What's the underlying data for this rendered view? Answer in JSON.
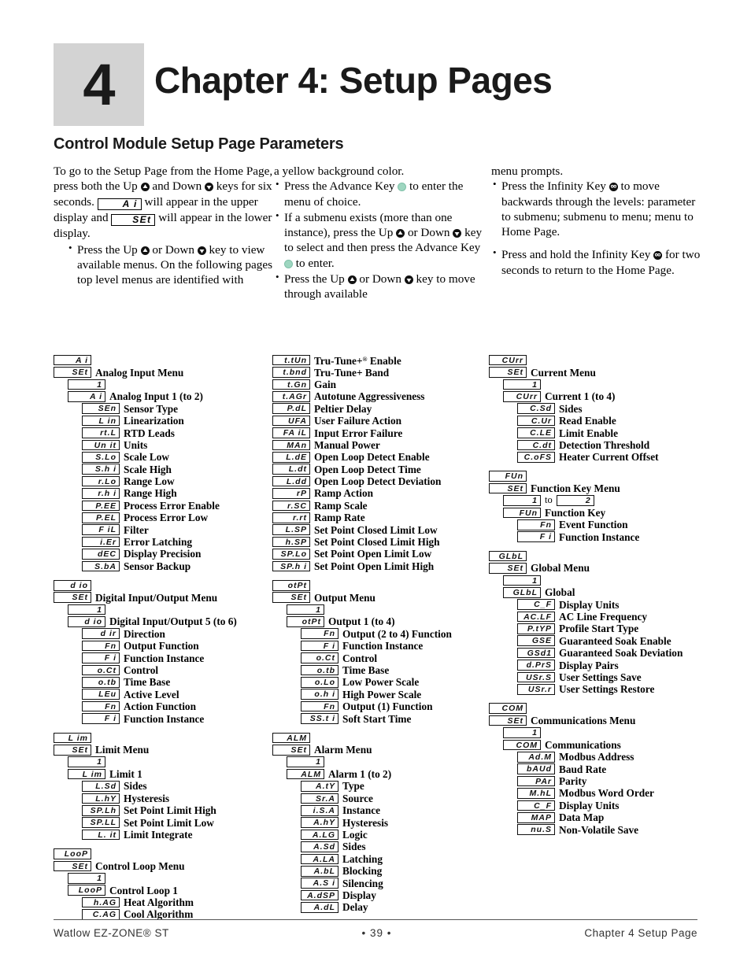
{
  "header": {
    "chapter_number": "4",
    "chapter_title": "Chapter 4: Setup Pages",
    "section_title": "Control Module Setup Page Parameters"
  },
  "intro": {
    "col1": {
      "para_a": "To go to the Setup Page from the Home Page, press both the Up",
      "para_b": "and Down",
      "para_c": "keys for six seconds.",
      "disp_ai": "A i",
      "para_d": "will appear in the upper display and",
      "disp_set": "SEt",
      "para_e": "will appear in the lower display.",
      "bullet1_a": "Press the Up",
      "bullet1_b": "or Down",
      "bullet1_c": "key to view available menus. On the following pages top level menus are identified with"
    },
    "col2": {
      "cont": "a yellow background color.",
      "bullet1_a": "Press the Advance Key",
      "bullet1_b": "to enter the menu of choice.",
      "bullet2_a": "If a submenu exists (more than one instance), press the Up",
      "bullet2_b": "or Down",
      "bullet2_c": "key to select and then press the Advance Key",
      "bullet2_d": "to enter.",
      "bullet3_a": "Press the Up",
      "bullet3_b": "or Down",
      "bullet3_c": "key to move through available"
    },
    "col3": {
      "cont": "menu prompts.",
      "bullet1_a": "Press the Infinity Key",
      "bullet1_b": "to move backwards through the levels: parameter to submenu; submenu to menu; menu to Home Page.",
      "bullet2_a": "Press and hold the Infinity Key",
      "bullet2_b": "for two seconds to return to the Home Page."
    }
  },
  "icons": {
    "up_key": "up-key-icon",
    "down_key": "down-key-icon",
    "advance_key": "advance-key-icon",
    "infinity_key": "infinity-key-icon",
    "advance_color": "#9ed6c0",
    "infinity_color": "#1a1a1a"
  },
  "tree": {
    "column1": [
      {
        "name": "analog-input-menu",
        "rows": [
          {
            "level": 0,
            "code": "A i",
            "label": ""
          },
          {
            "level": 0,
            "code": "SEt",
            "label": "Analog Input Menu"
          },
          {
            "level": 1,
            "code": "1",
            "label": ""
          },
          {
            "level": 1,
            "code": "A i",
            "label": "Analog Input 1 (to 2)"
          },
          {
            "level": 2,
            "code": "SEn",
            "label": "Sensor Type"
          },
          {
            "level": 2,
            "code": "L in",
            "label": "Linearization"
          },
          {
            "level": 2,
            "code": "rt.L",
            "label": "RTD Leads"
          },
          {
            "level": 2,
            "code": "Un it",
            "label": "Units"
          },
          {
            "level": 2,
            "code": "S.Lo",
            "label": "Scale Low"
          },
          {
            "level": 2,
            "code": "S.h i",
            "label": "Scale High"
          },
          {
            "level": 2,
            "code": "r.Lo",
            "label": "Range Low"
          },
          {
            "level": 2,
            "code": "r.h i",
            "label": "Range High"
          },
          {
            "level": 2,
            "code": "P.EE",
            "label": "Process Error Enable"
          },
          {
            "level": 2,
            "code": "P.EL",
            "label": "Process Error Low"
          },
          {
            "level": 2,
            "code": "F iL",
            "label": "Filter"
          },
          {
            "level": 2,
            "code": "i.Er",
            "label": "Error Latching"
          },
          {
            "level": 2,
            "code": "dEC",
            "label": "Display Precision"
          },
          {
            "level": 2,
            "code": "S.bA",
            "label": "Sensor Backup"
          }
        ]
      },
      {
        "name": "digital-io-menu",
        "rows": [
          {
            "level": 0,
            "code": "d io",
            "label": ""
          },
          {
            "level": 0,
            "code": "SEt",
            "label": "Digital Input/Output Menu"
          },
          {
            "level": 1,
            "code": "1",
            "label": ""
          },
          {
            "level": 1,
            "code": "d io",
            "label": "Digital Input/Output 5 (to 6)"
          },
          {
            "level": 2,
            "code": "d ir",
            "label": "Direction"
          },
          {
            "level": 2,
            "code": "Fn",
            "label": "Output Function"
          },
          {
            "level": 2,
            "code": "F i",
            "label": "Function Instance"
          },
          {
            "level": 2,
            "code": "o.Ct",
            "label": "Control"
          },
          {
            "level": 2,
            "code": "o.tb",
            "label": "Time Base"
          },
          {
            "level": 2,
            "code": "LEu",
            "label": "Active Level"
          },
          {
            "level": 2,
            "code": "Fn",
            "label": "Action Function"
          },
          {
            "level": 2,
            "code": "F i",
            "label": "Function Instance"
          }
        ]
      },
      {
        "name": "limit-menu",
        "rows": [
          {
            "level": 0,
            "code": "L im",
            "label": ""
          },
          {
            "level": 0,
            "code": "SEt",
            "label": "Limit Menu"
          },
          {
            "level": 1,
            "code": "1",
            "label": ""
          },
          {
            "level": 1,
            "code": "L im",
            "label": "Limit 1"
          },
          {
            "level": 2,
            "code": "L.Sd",
            "label": "Sides"
          },
          {
            "level": 2,
            "code": "L.hY",
            "label": "Hysteresis"
          },
          {
            "level": 2,
            "code": "SP.Lh",
            "label": "Set Point Limit High"
          },
          {
            "level": 2,
            "code": "SP.LL",
            "label": "Set Point Limit Low"
          },
          {
            "level": 2,
            "code": "L. it",
            "label": "Limit Integrate"
          }
        ]
      },
      {
        "name": "control-loop-menu",
        "rows": [
          {
            "level": 0,
            "code": "LooP",
            "label": ""
          },
          {
            "level": 0,
            "code": "SEt",
            "label": "Control Loop Menu"
          },
          {
            "level": 1,
            "code": "1",
            "label": ""
          },
          {
            "level": 1,
            "code": "LooP",
            "label": "Control Loop 1"
          },
          {
            "level": 2,
            "code": "h.AG",
            "label": "Heat Algorithm"
          },
          {
            "level": 2,
            "code": "C.AG",
            "label": "Cool Algorithm"
          }
        ]
      }
    ],
    "column2": [
      {
        "name": "control-loop-continued",
        "rows": [
          {
            "level": 0,
            "code": "t.tUn",
            "label": "Tru-Tune+® Enable"
          },
          {
            "level": 0,
            "code": "t.bnd",
            "label": "Tru-Tune+ Band"
          },
          {
            "level": 0,
            "code": "t.Gn",
            "label": "Gain"
          },
          {
            "level": 0,
            "code": "t.AGr",
            "label": "Autotune Aggressiveness"
          },
          {
            "level": 0,
            "code": "P.dL",
            "label": "Peltier Delay"
          },
          {
            "level": 0,
            "code": "UFA",
            "label": "User Failure Action"
          },
          {
            "level": 0,
            "code": "FA iL",
            "label": "Input Error Failure"
          },
          {
            "level": 0,
            "code": "MAn",
            "label": "Manual Power"
          },
          {
            "level": 0,
            "code": "L.dE",
            "label": "Open Loop Detect Enable"
          },
          {
            "level": 0,
            "code": "L.dt",
            "label": "Open Loop Detect Time"
          },
          {
            "level": 0,
            "code": "L.dd",
            "label": "Open Loop Detect Deviation"
          },
          {
            "level": 0,
            "code": "rP",
            "label": "Ramp Action"
          },
          {
            "level": 0,
            "code": "r.SC",
            "label": "Ramp Scale"
          },
          {
            "level": 0,
            "code": "r.rt",
            "label": "Ramp Rate"
          },
          {
            "level": 0,
            "code": "L.SP",
            "label": "Set Point Closed Limit Low"
          },
          {
            "level": 0,
            "code": "h.SP",
            "label": "Set Point Closed Limit High"
          },
          {
            "level": 0,
            "code": "SP.Lo",
            "label": "Set Point Open Limit Low"
          },
          {
            "level": 0,
            "code": "SP.h i",
            "label": "Set Point Open Limit High"
          }
        ]
      },
      {
        "name": "output-menu",
        "rows": [
          {
            "level": 0,
            "code": "otPt",
            "label": ""
          },
          {
            "level": 0,
            "code": "SEt",
            "label": "Output Menu"
          },
          {
            "level": 1,
            "code": "1",
            "label": ""
          },
          {
            "level": 1,
            "code": "otPt",
            "label": "Output 1 (to 4)"
          },
          {
            "level": 2,
            "code": "Fn",
            "label": "Output (2 to 4) Function"
          },
          {
            "level": 2,
            "code": "F i",
            "label": "Function Instance"
          },
          {
            "level": 2,
            "code": "o.Ct",
            "label": "Control"
          },
          {
            "level": 2,
            "code": "o.tb",
            "label": "Time Base"
          },
          {
            "level": 2,
            "code": "o.Lo",
            "label": "Low Power Scale"
          },
          {
            "level": 2,
            "code": "o.h i",
            "label": "High Power Scale"
          },
          {
            "level": 2,
            "code": "Fn",
            "label": "Output (1) Function"
          },
          {
            "level": 2,
            "code": "SS.t i",
            "label": "Soft Start Time"
          }
        ]
      },
      {
        "name": "alarm-menu",
        "rows": [
          {
            "level": 0,
            "code": "ALM",
            "label": ""
          },
          {
            "level": 0,
            "code": "SEt",
            "label": "Alarm Menu"
          },
          {
            "level": 1,
            "code": "1",
            "label": ""
          },
          {
            "level": 1,
            "code": "ALM",
            "label": "Alarm 1 (to 2)"
          },
          {
            "level": 2,
            "code": "A.tY",
            "label": "Type"
          },
          {
            "level": 2,
            "code": "Sr.A",
            "label": "Source"
          },
          {
            "level": 2,
            "code": "i.S.A",
            "label": "Instance"
          },
          {
            "level": 2,
            "code": "A.hY",
            "label": "Hysteresis"
          },
          {
            "level": 2,
            "code": "A.LG",
            "label": "Logic"
          },
          {
            "level": 2,
            "code": "A.Sd",
            "label": "Sides"
          },
          {
            "level": 2,
            "code": "A.LA",
            "label": "Latching"
          },
          {
            "level": 2,
            "code": "A.bL",
            "label": "Blocking"
          },
          {
            "level": 2,
            "code": "A.S i",
            "label": "Silencing"
          },
          {
            "level": 2,
            "code": "A.dSP",
            "label": "Display"
          },
          {
            "level": 2,
            "code": "A.dL",
            "label": "Delay"
          }
        ]
      }
    ],
    "column3": [
      {
        "name": "current-menu",
        "rows": [
          {
            "level": 0,
            "code": "CUrr",
            "label": ""
          },
          {
            "level": 0,
            "code": "SEt",
            "label": "Current Menu"
          },
          {
            "level": 1,
            "code": "1",
            "label": ""
          },
          {
            "level": 1,
            "code": "CUrr",
            "label": "Current 1 (to 4)"
          },
          {
            "level": 2,
            "code": "C.Sd",
            "label": "Sides"
          },
          {
            "level": 2,
            "code": "C.Ur",
            "label": "Read Enable"
          },
          {
            "level": 2,
            "code": "C.LE",
            "label": "Limit Enable"
          },
          {
            "level": 2,
            "code": "C.dt",
            "label": "Detection Threshold"
          },
          {
            "level": 2,
            "code": "C.oFS",
            "label": "Heater Current Offset"
          }
        ]
      },
      {
        "name": "function-key-menu",
        "rows": [
          {
            "level": 0,
            "code": "FUn",
            "label": ""
          },
          {
            "level": 0,
            "code": "SEt",
            "label": "Function Key Menu"
          },
          {
            "level": 1,
            "code": "1",
            "mid": "to",
            "code2": "2",
            "label": ""
          },
          {
            "level": 1,
            "code": "FUn",
            "label": "Function Key"
          },
          {
            "level": 2,
            "code": "Fn",
            "label": "Event Function"
          },
          {
            "level": 2,
            "code": "F i",
            "label": "Function Instance"
          }
        ]
      },
      {
        "name": "global-menu",
        "rows": [
          {
            "level": 0,
            "code": "GLbL",
            "label": ""
          },
          {
            "level": 0,
            "code": "SEt",
            "label": "Global Menu"
          },
          {
            "level": 1,
            "code": "1",
            "label": ""
          },
          {
            "level": 1,
            "code": "GLbL",
            "label": "Global"
          },
          {
            "level": 2,
            "code": "C_F",
            "label": "Display Units"
          },
          {
            "level": 2,
            "code": "AC.LF",
            "label": "AC Line Frequency"
          },
          {
            "level": 2,
            "code": "P.tYP",
            "label": "Profile Start Type"
          },
          {
            "level": 2,
            "code": "GSE",
            "label": "Guaranteed Soak Enable"
          },
          {
            "level": 2,
            "code": "GSd1",
            "label": "Guaranteed Soak Deviation"
          },
          {
            "level": 2,
            "code": "d.PrS",
            "label": "Display Pairs"
          },
          {
            "level": 2,
            "code": "USr.S",
            "label": "User Settings Save"
          },
          {
            "level": 2,
            "code": "USr.r",
            "label": "User Settings Restore"
          }
        ]
      },
      {
        "name": "communications-menu",
        "rows": [
          {
            "level": 0,
            "code": "COM",
            "label": ""
          },
          {
            "level": 0,
            "code": "SEt",
            "label": "Communications Menu"
          },
          {
            "level": 1,
            "code": "1",
            "label": ""
          },
          {
            "level": 1,
            "code": "COM",
            "label": "Communications"
          },
          {
            "level": 2,
            "code": "Ad.M",
            "label": "Modbus Address"
          },
          {
            "level": 2,
            "code": "bAUd",
            "label": "Baud Rate"
          },
          {
            "level": 2,
            "code": "PAr",
            "label": "Parity"
          },
          {
            "level": 2,
            "code": "M.hL",
            "label": "Modbus Word Order"
          },
          {
            "level": 2,
            "code": "C_F",
            "label": "Display Units"
          },
          {
            "level": 2,
            "code": "MAP",
            "label": "Data Map"
          },
          {
            "level": 2,
            "code": "nu.S",
            "label": "Non-Volatile Save"
          }
        ]
      }
    ]
  },
  "footer": {
    "left": "Watlow EZ-ZONE® ST",
    "center": "• 39 •",
    "right": "Chapter 4 Setup Page"
  }
}
